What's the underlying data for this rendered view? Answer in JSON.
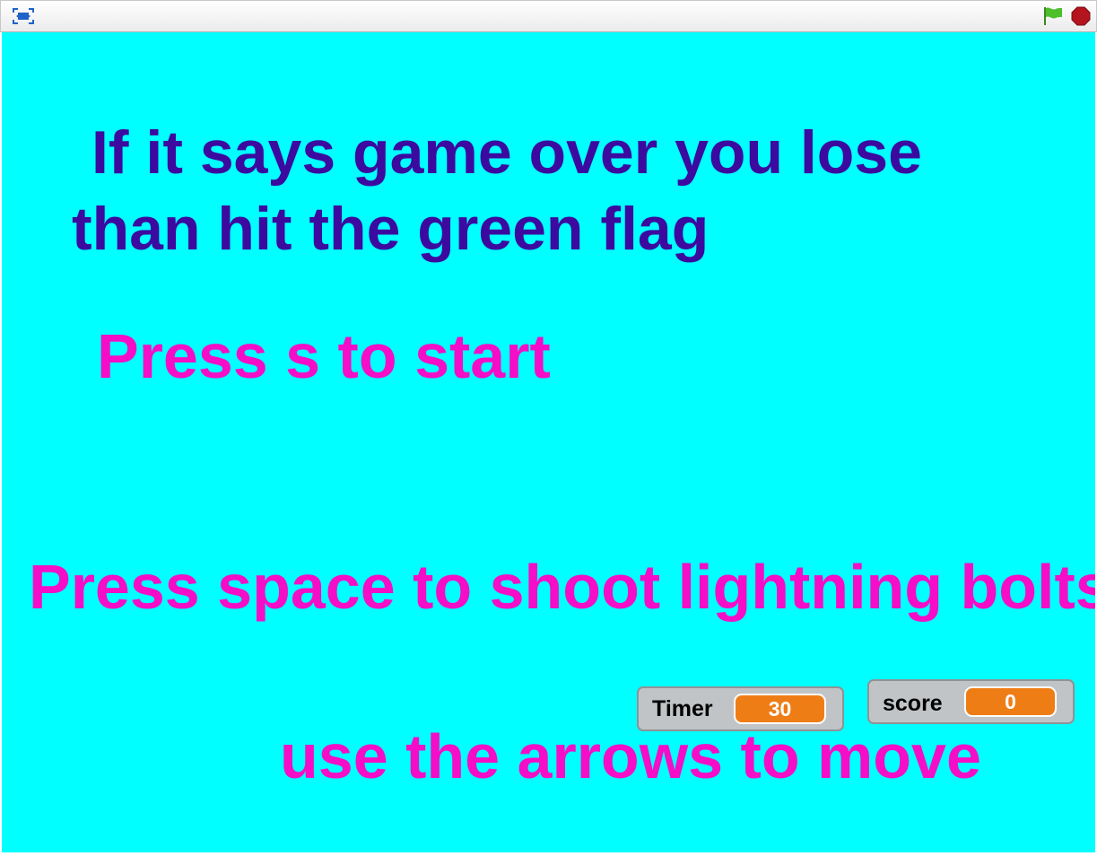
{
  "toolbar": {
    "fullscreen_icon": "fullscreen-icon",
    "green_flag_icon": "green-flag-icon",
    "stop_icon": "stop-sign-icon",
    "colors": {
      "fullscreen": "#1e64c8",
      "green_flag": "#4cbf2a",
      "stop": "#b4141e"
    }
  },
  "stage": {
    "background_color": "#00ffff",
    "instructions": {
      "game_over_line_1": "If it says game over you lose",
      "game_over_line_2": "than hit the green flag",
      "start": "Press s to start",
      "shoot": "Press space to shoot lightning bolts",
      "move": "use the arrows to move"
    },
    "colors": {
      "game_over_text": "#3d0aa0",
      "instruction_text": "#f50dc7"
    }
  },
  "monitors": {
    "timer": {
      "label": "Timer",
      "value": "30"
    },
    "score": {
      "label": "score",
      "value": "0"
    },
    "colors": {
      "background": "#c1c4c7",
      "value_background": "#ee7d16"
    }
  }
}
